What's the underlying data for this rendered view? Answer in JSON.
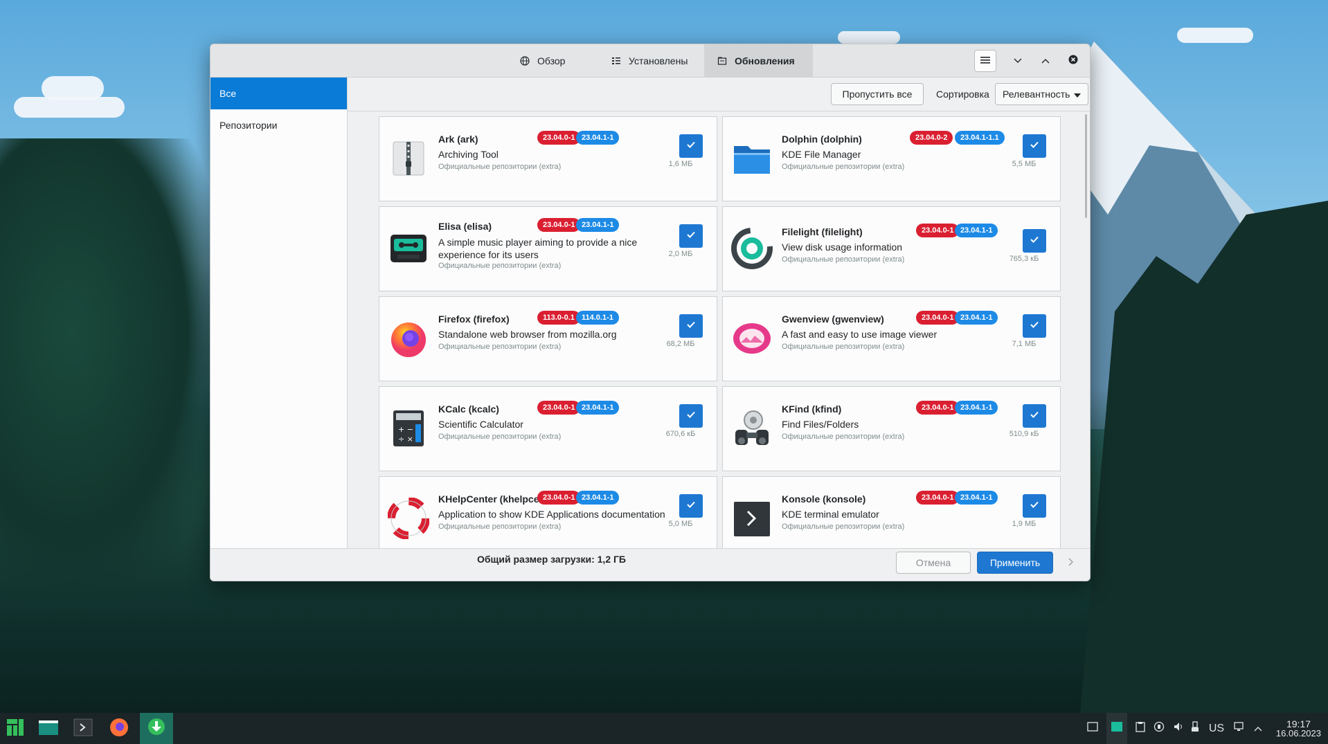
{
  "window": {
    "tabs": [
      {
        "label": "Обзор",
        "icon": "globe-icon"
      },
      {
        "label": "Установлены",
        "icon": "list-icon"
      },
      {
        "label": "Обновления",
        "icon": "updates-icon"
      }
    ],
    "active_tab": 2
  },
  "sidebar": {
    "items": [
      {
        "label": "Все"
      },
      {
        "label": "Репозитории"
      }
    ]
  },
  "toolbar": {
    "skip_all": "Пропустить все",
    "sort_label": "Сортировка",
    "sort_value": "Релевантность"
  },
  "updates": [
    {
      "name": "Ark (ark)",
      "desc": "Archiving Tool",
      "repo": "Официальные репозитории (extra)",
      "old": "23.04.0-1",
      "new": "23.04.1-1",
      "size": "1,6 МБ",
      "icon": "ark-icon"
    },
    {
      "name": "Dolphin (dolphin)",
      "desc": "KDE File Manager",
      "repo": "Официальные репозитории (extra)",
      "old": "23.04.0-2",
      "new": "23.04.1-1.1",
      "size": "5,5 МБ",
      "icon": "dolphin-icon"
    },
    {
      "name": "Elisa (elisa)",
      "desc": "A simple music player aiming to provide a nice experience for its users",
      "repo": "Официальные репозитории (extra)",
      "old": "23.04.0-1",
      "new": "23.04.1-1",
      "size": "2,0 МБ",
      "icon": "elisa-icon"
    },
    {
      "name": "Filelight (filelight)",
      "desc": "View disk usage information",
      "repo": "Официальные репозитории (extra)",
      "old": "23.04.0-1",
      "new": "23.04.1-1",
      "size": "765,3 кБ",
      "icon": "filelight-icon"
    },
    {
      "name": "Firefox (firefox)",
      "desc": "Standalone web browser from mozilla.org",
      "repo": "Официальные репозитории (extra)",
      "old": "113.0-0.1",
      "new": "114.0.1-1",
      "size": "68,2 МБ",
      "icon": "firefox-icon"
    },
    {
      "name": "Gwenview (gwenview)",
      "desc": "A fast and easy to use image viewer",
      "repo": "Официальные репозитории (extra)",
      "old": "23.04.0-1",
      "new": "23.04.1-1",
      "size": "7,1 МБ",
      "icon": "gwenview-icon"
    },
    {
      "name": "KCalc (kcalc)",
      "desc": "Scientific Calculator",
      "repo": "Официальные репозитории (extra)",
      "old": "23.04.0-1",
      "new": "23.04.1-1",
      "size": "670,6 кБ",
      "icon": "kcalc-icon"
    },
    {
      "name": "KFind (kfind)",
      "desc": "Find Files/Folders",
      "repo": "Официальные репозитории (extra)",
      "old": "23.04.0-1",
      "new": "23.04.1-1",
      "size": "510,9 кБ",
      "icon": "kfind-icon"
    },
    {
      "name": "KHelpCenter (khelpcenter)",
      "desc": "Application to show KDE Applications documentation",
      "repo": "Официальные репозитории (extra)",
      "old": "23.04.0-1",
      "new": "23.04.1-1",
      "size": "5,0 МБ",
      "icon": "khelpcenter-icon"
    },
    {
      "name": "Konsole (konsole)",
      "desc": "KDE terminal emulator",
      "repo": "Официальные репозитории (extra)",
      "old": "23.04.0-1",
      "new": "23.04.1-1",
      "size": "1,9 МБ",
      "icon": "konsole-icon"
    }
  ],
  "footer": {
    "total": "Общий размер загрузки: 1,2 ГБ",
    "cancel": "Отмена",
    "apply": "Применить"
  },
  "taskbar": {
    "keyboard_layout": "US",
    "time": "19:17",
    "date": "16.06.2023"
  },
  "colors": {
    "accent": "#1e78d2",
    "old_version": "#da1f31",
    "new_version": "#1d8ae6"
  }
}
